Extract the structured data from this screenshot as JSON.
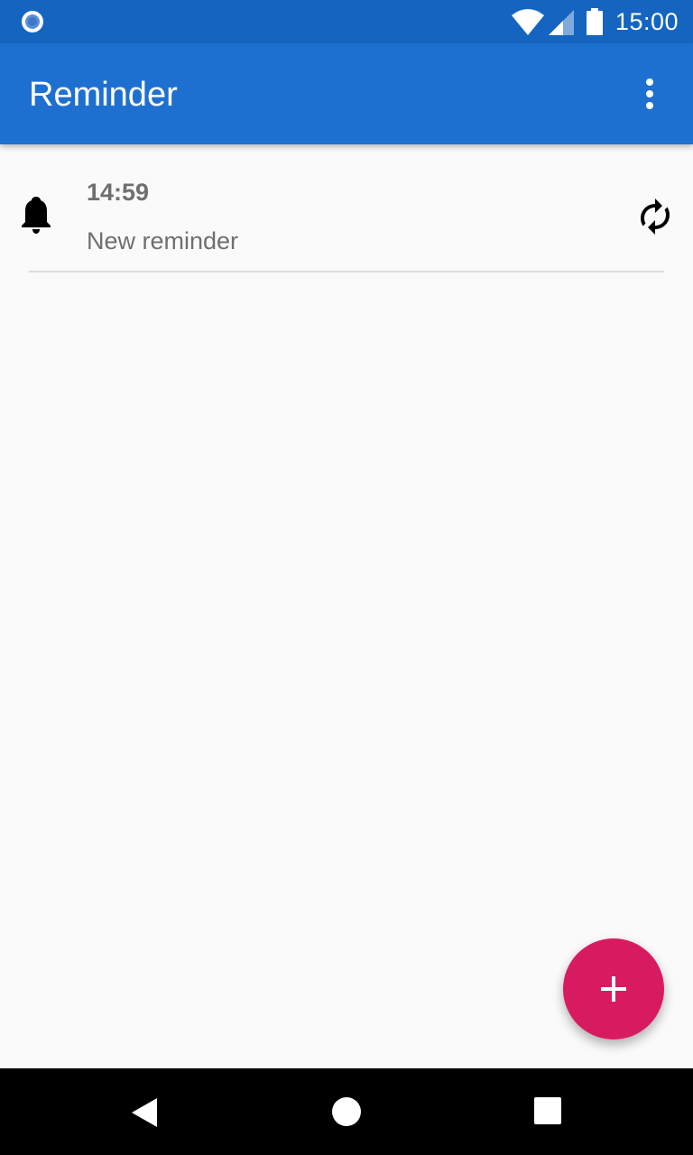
{
  "status_bar": {
    "time": "15:00",
    "icons": [
      "sync-status-icon",
      "wifi-icon",
      "signal-icon",
      "battery-icon"
    ]
  },
  "app_bar": {
    "title": "Reminder",
    "overflow_icon": "more-vert-icon"
  },
  "reminders": [
    {
      "time": "14:59",
      "text": "New reminder",
      "leading_icon": "bell-icon",
      "trailing_icon": "repeat-icon"
    }
  ],
  "fab": {
    "icon": "plus-icon",
    "color": "#d81b60"
  },
  "nav_bar": {
    "icons": [
      "back-icon",
      "home-icon",
      "recents-icon"
    ]
  },
  "colors": {
    "status_bar": "#1565c0",
    "app_bar": "#1e70d0",
    "accent": "#d81b60",
    "background": "#fafafa"
  }
}
